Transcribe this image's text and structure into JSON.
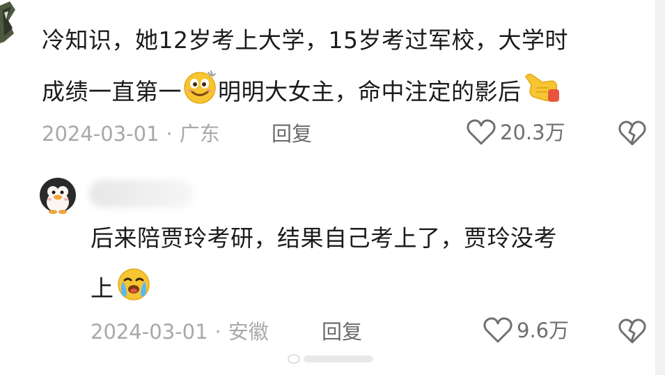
{
  "comments": [
    {
      "text_line1": "冷知识，她12岁考上大学，15岁考过军校，大学时",
      "text_line2_a": "成绩一直第一",
      "text_line2_b": "明明大女主，命中注定的影后",
      "emoji_inline": "grinning-face-emoji",
      "emoji_end": "pointing-hand-emoji",
      "date": "2024-03-01",
      "location": "广东",
      "reply_label": "回复",
      "like_count": "20.3万"
    },
    {
      "text_line1": "后来陪贾玲考研，结果自己考上了，贾玲没考",
      "text_line2": "上",
      "emoji_end": "crying-face-emoji",
      "date": "2024-03-01",
      "location": "安徽",
      "reply_label": "回复",
      "like_count": "9.6万"
    }
  ],
  "icons": {
    "like": "heart-outline-icon",
    "dislike": "broken-heart-icon"
  },
  "colors": {
    "text": "#1b1b1b",
    "meta": "#a8a8a8",
    "action": "#6f6f6f",
    "emoji_yellow": "#f7c531"
  }
}
